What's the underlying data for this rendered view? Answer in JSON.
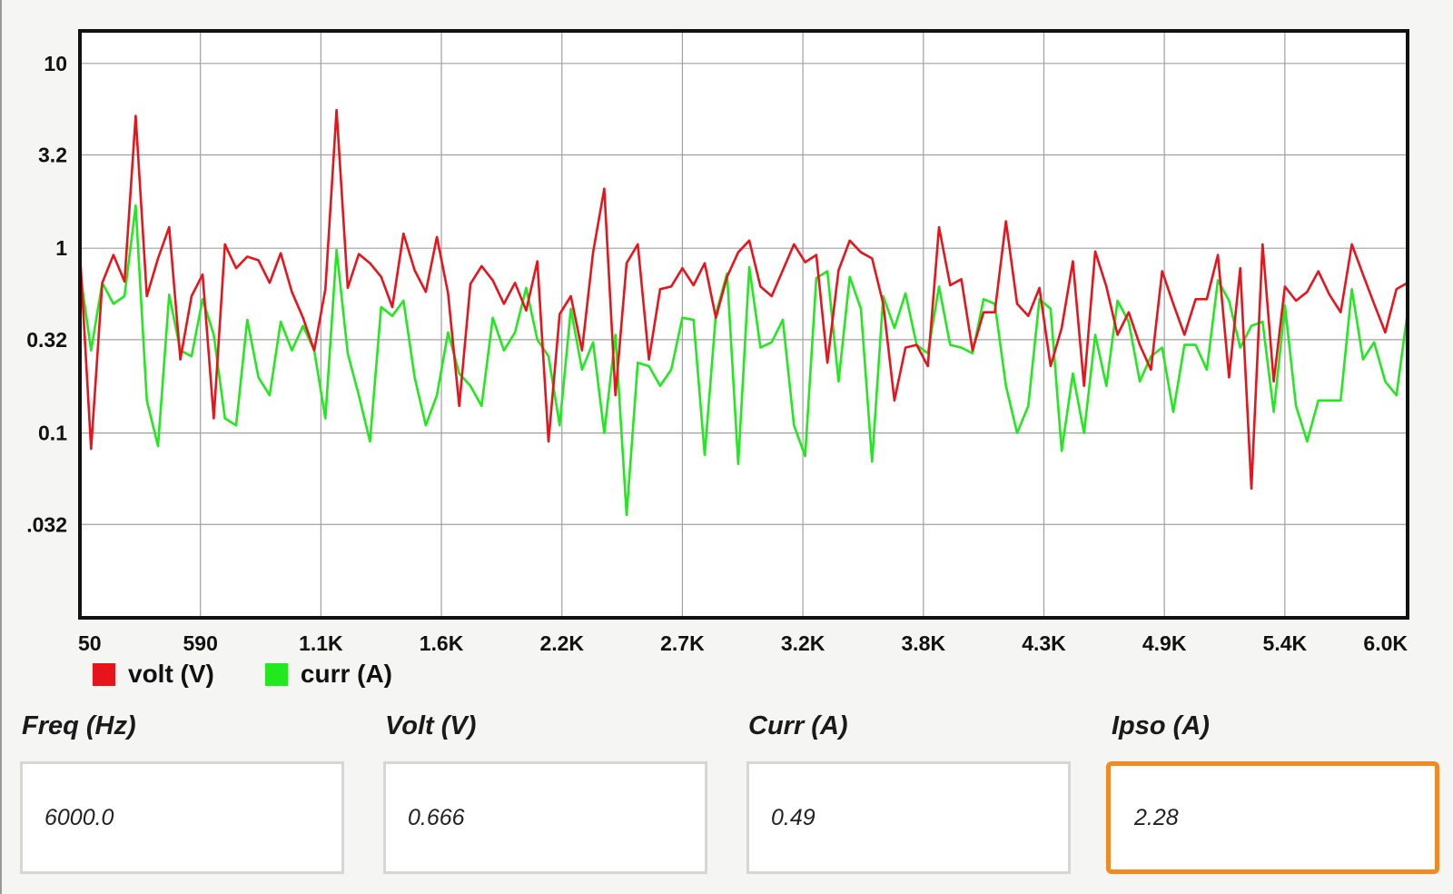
{
  "chart_data": {
    "type": "line",
    "ylog": true,
    "ylim": [
      0.01,
      15
    ],
    "xlim": [
      50,
      6000
    ],
    "y_ticks": [
      {
        "value": 10,
        "label": "10"
      },
      {
        "value": 3.2,
        "label": "3.2"
      },
      {
        "value": 1,
        "label": "1"
      },
      {
        "value": 0.32,
        "label": "0.32"
      },
      {
        "value": 0.1,
        "label": "0.1"
      },
      {
        "value": 0.032,
        "label": ".032"
      }
    ],
    "x_ticks": [
      {
        "value": 50,
        "label": "50"
      },
      {
        "value": 590,
        "label": "590"
      },
      {
        "value": 1130,
        "label": "1.1K"
      },
      {
        "value": 1670,
        "label": "1.6K"
      },
      {
        "value": 2210,
        "label": "2.2K"
      },
      {
        "value": 2750,
        "label": "2.7K"
      },
      {
        "value": 3290,
        "label": "3.2K"
      },
      {
        "value": 3830,
        "label": "3.8K"
      },
      {
        "value": 4370,
        "label": "4.3K"
      },
      {
        "value": 4910,
        "label": "4.9K"
      },
      {
        "value": 5450,
        "label": "5.4K"
      },
      {
        "value": 6000,
        "label": "6.0K"
      }
    ],
    "grid": true,
    "legend_position": "bottom-left",
    "series": [
      {
        "name": "volt (V)",
        "color": "#e8141c",
        "x": [
          50,
          100,
          150,
          200,
          250,
          300,
          350,
          400,
          450,
          500,
          550,
          600,
          650,
          700,
          750,
          800,
          850,
          900,
          950,
          1000,
          1050,
          1100,
          1150,
          1200,
          1250,
          1300,
          1350,
          1400,
          1450,
          1500,
          1550,
          1600,
          1650,
          1700,
          1750,
          1800,
          1850,
          1900,
          1950,
          2000,
          2050,
          2100,
          2150,
          2200,
          2250,
          2300,
          2350,
          2400,
          2450,
          2500,
          2550,
          2600,
          2650,
          2700,
          2750,
          2800,
          2850,
          2900,
          2950,
          3000,
          3050,
          3100,
          3150,
          3200,
          3250,
          3300,
          3350,
          3400,
          3450,
          3500,
          3550,
          3600,
          3650,
          3700,
          3750,
          3800,
          3850,
          3900,
          3950,
          4000,
          4050,
          4100,
          4150,
          4200,
          4250,
          4300,
          4350,
          4400,
          4450,
          4500,
          4550,
          4600,
          4650,
          4700,
          4750,
          4800,
          4850,
          4900,
          4950,
          5000,
          5050,
          5100,
          5150,
          5200,
          5250,
          5300,
          5350,
          5400,
          5450,
          5500,
          5550,
          5600,
          5650,
          5700,
          5750,
          5800,
          5850,
          5900,
          5950,
          6000
        ],
        "values": [
          0.95,
          0.082,
          0.65,
          0.92,
          0.66,
          5.2,
          0.55,
          0.88,
          1.3,
          0.25,
          0.55,
          0.72,
          0.12,
          1.05,
          0.78,
          0.9,
          0.86,
          0.65,
          0.94,
          0.58,
          0.42,
          0.28,
          0.6,
          5.6,
          0.61,
          0.93,
          0.83,
          0.7,
          0.48,
          1.2,
          0.76,
          0.58,
          1.15,
          0.57,
          0.14,
          0.64,
          0.8,
          0.67,
          0.5,
          0.65,
          0.46,
          0.85,
          0.09,
          0.44,
          0.55,
          0.28,
          0.95,
          2.1,
          0.16,
          0.83,
          1.05,
          0.25,
          0.6,
          0.62,
          0.78,
          0.63,
          0.83,
          0.42,
          0.7,
          0.95,
          1.1,
          0.62,
          0.55,
          0.76,
          1.05,
          0.84,
          0.92,
          0.24,
          0.76,
          1.1,
          0.95,
          0.88,
          0.5,
          0.15,
          0.29,
          0.3,
          0.23,
          1.3,
          0.63,
          0.68,
          0.28,
          0.45,
          0.45,
          1.4,
          0.5,
          0.43,
          0.61,
          0.23,
          0.37,
          0.85,
          0.18,
          0.96,
          0.62,
          0.34,
          0.45,
          0.3,
          0.22,
          0.75,
          0.5,
          0.34,
          0.53,
          0.53,
          0.92,
          0.2,
          0.78,
          0.05,
          1.05,
          0.19,
          0.62,
          0.52,
          0.58,
          0.75,
          0.56,
          0.45,
          1.05,
          0.72,
          0.5,
          0.35,
          0.6,
          0.65
        ]
      },
      {
        "name": "curr (A)",
        "color": "#22e81e",
        "x": [
          50,
          100,
          150,
          200,
          250,
          300,
          350,
          400,
          450,
          500,
          550,
          600,
          650,
          700,
          750,
          800,
          850,
          900,
          950,
          1000,
          1050,
          1100,
          1150,
          1200,
          1250,
          1300,
          1350,
          1400,
          1450,
          1500,
          1550,
          1600,
          1650,
          1700,
          1750,
          1800,
          1850,
          1900,
          1950,
          2000,
          2050,
          2100,
          2150,
          2200,
          2250,
          2300,
          2350,
          2400,
          2450,
          2500,
          2550,
          2600,
          2650,
          2700,
          2750,
          2800,
          2850,
          2900,
          2950,
          3000,
          3050,
          3100,
          3150,
          3200,
          3250,
          3300,
          3350,
          3400,
          3450,
          3500,
          3550,
          3600,
          3650,
          3700,
          3750,
          3800,
          3850,
          3900,
          3950,
          4000,
          4050,
          4100,
          4150,
          4200,
          4250,
          4300,
          4350,
          4400,
          4450,
          4500,
          4550,
          4600,
          4650,
          4700,
          4750,
          4800,
          4850,
          4900,
          4950,
          5000,
          5050,
          5100,
          5150,
          5200,
          5250,
          5300,
          5350,
          5400,
          5450,
          5500,
          5550,
          5600,
          5650,
          5700,
          5750,
          5800,
          5850,
          5900,
          5950,
          6000
        ],
        "values": [
          0.75,
          0.28,
          0.65,
          0.5,
          0.55,
          1.7,
          0.15,
          0.085,
          0.56,
          0.28,
          0.26,
          0.53,
          0.34,
          0.12,
          0.11,
          0.41,
          0.2,
          0.16,
          0.4,
          0.28,
          0.38,
          0.28,
          0.12,
          0.98,
          0.27,
          0.16,
          0.09,
          0.48,
          0.43,
          0.52,
          0.2,
          0.11,
          0.16,
          0.35,
          0.21,
          0.18,
          0.14,
          0.42,
          0.28,
          0.35,
          0.61,
          0.32,
          0.26,
          0.11,
          0.47,
          0.22,
          0.31,
          0.1,
          0.34,
          0.036,
          0.24,
          0.23,
          0.18,
          0.22,
          0.42,
          0.41,
          0.076,
          0.44,
          0.73,
          0.068,
          0.79,
          0.29,
          0.31,
          0.41,
          0.11,
          0.075,
          0.69,
          0.75,
          0.19,
          0.7,
          0.47,
          0.07,
          0.55,
          0.37,
          0.57,
          0.3,
          0.27,
          0.62,
          0.3,
          0.29,
          0.27,
          0.53,
          0.5,
          0.18,
          0.1,
          0.14,
          0.53,
          0.47,
          0.08,
          0.21,
          0.1,
          0.34,
          0.18,
          0.52,
          0.4,
          0.19,
          0.26,
          0.29,
          0.13,
          0.3,
          0.3,
          0.22,
          0.67,
          0.52,
          0.29,
          0.38,
          0.4,
          0.13,
          0.49,
          0.14,
          0.09,
          0.15,
          0.15,
          0.15,
          0.6,
          0.25,
          0.31,
          0.19,
          0.16,
          0.45
        ]
      }
    ]
  },
  "fields": [
    {
      "label": "Freq (Hz)",
      "value": "6000.0"
    },
    {
      "label": "Volt (V)",
      "value": "0.666"
    },
    {
      "label": "Curr (A)",
      "value": "0.49"
    },
    {
      "label": "Ipso (A)",
      "value": "2.28"
    }
  ],
  "colors": {
    "active_border": "#f08a24"
  }
}
